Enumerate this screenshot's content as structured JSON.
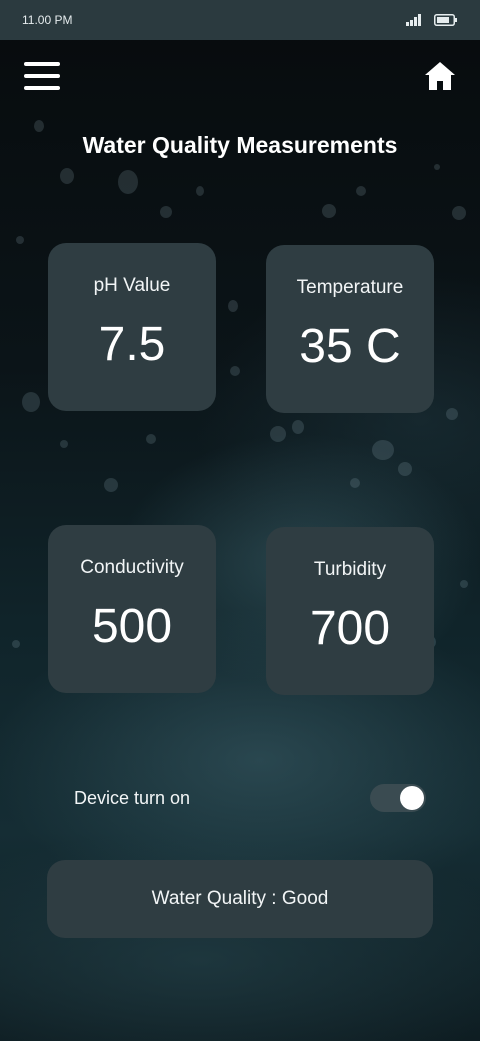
{
  "status_bar": {
    "time": "11.00 PM",
    "icons": [
      "signal-icon",
      "battery-icon"
    ]
  },
  "header": {
    "menu_icon": "hamburger-menu-icon",
    "home_icon": "home-icon",
    "title": "Water Quality Measurements"
  },
  "measurements": [
    {
      "label": "pH Value",
      "value": "7.5"
    },
    {
      "label": "Temperature",
      "value": "35 C"
    },
    {
      "label": "Conductivity",
      "value": "500"
    },
    {
      "label": "Turbidity",
      "value": "700"
    }
  ],
  "device": {
    "label": "Device turn on",
    "toggle_on": true
  },
  "quality": {
    "text": "Water Quality : Good"
  },
  "colors": {
    "card_background": "#2f3d42",
    "status_bar": "#2b3a3f",
    "text": "#ffffff"
  }
}
